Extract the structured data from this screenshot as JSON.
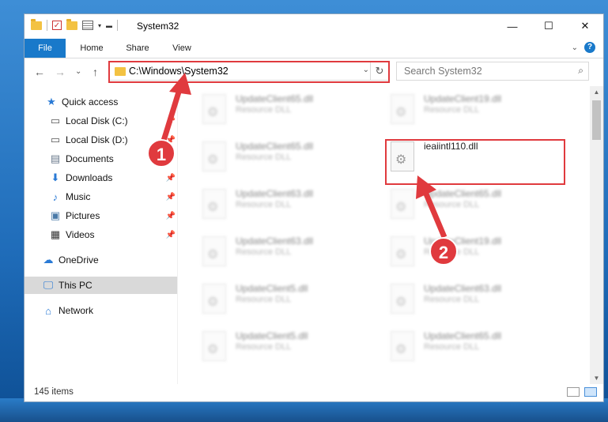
{
  "window": {
    "title": "System32",
    "controls": {
      "minimize": "—",
      "maximize": "☐",
      "close": "✕"
    }
  },
  "ribbon": {
    "tabs": [
      {
        "label": "File",
        "active": true
      },
      {
        "label": "Home"
      },
      {
        "label": "Share"
      },
      {
        "label": "View"
      }
    ],
    "help": "?"
  },
  "nav": {
    "back": "←",
    "forward": "→",
    "recent": "⌄",
    "up": "↑",
    "address": "C:\\Windows\\System32",
    "refresh": "↻",
    "search_placeholder": "Search System32"
  },
  "sidebar": {
    "items": [
      {
        "label": "Quick access",
        "icon": "star-icon"
      },
      {
        "label": "Local Disk (C:)",
        "icon": "drive-icon"
      },
      {
        "label": "Local Disk (D:)",
        "icon": "drive-icon"
      },
      {
        "label": "Documents",
        "icon": "documents-icon"
      },
      {
        "label": "Downloads",
        "icon": "download-icon"
      },
      {
        "label": "Music",
        "icon": "music-icon"
      },
      {
        "label": "Pictures",
        "icon": "pictures-icon"
      },
      {
        "label": "Videos",
        "icon": "videos-icon"
      },
      {
        "label": "OneDrive",
        "icon": "cloud-icon"
      },
      {
        "label": "This PC",
        "icon": "computer-icon",
        "selected": true
      },
      {
        "label": "Network",
        "icon": "network-icon"
      }
    ]
  },
  "files": {
    "left": [
      {
        "name": "UpdateClient65.dll",
        "type": "Resource DLL"
      },
      {
        "name": "UpdateClient65.dll",
        "type": "Resource DLL"
      },
      {
        "name": "UpdateClient63.dll",
        "type": "Resource DLL"
      },
      {
        "name": "UpdateClient63.dll",
        "type": "Resource DLL"
      },
      {
        "name": "UpdateClient5.dll",
        "type": "Resource DLL"
      },
      {
        "name": "UpdateClient5.dll",
        "type": "Resource DLL"
      }
    ],
    "right": [
      {
        "name": "UpdateClient19.dll",
        "type": "Resource DLL"
      },
      {
        "name": "ieaiintl110.dll",
        "type": "",
        "highlighted": true
      },
      {
        "name": "UpdateClient65.dll",
        "type": "Resource DLL"
      },
      {
        "name": "UpdateClient19.dll",
        "type": "Resource DLL"
      },
      {
        "name": "UpdateClient63.dll",
        "type": "Resource DLL"
      },
      {
        "name": "UpdateClient65.dll",
        "type": "Resource DLL"
      }
    ]
  },
  "status": {
    "count": "145 items"
  },
  "callouts": {
    "first": "1",
    "second": "2"
  },
  "colors": {
    "accent": "#1979ca",
    "highlight": "#e03a3e",
    "selected": "#d9d9d9"
  }
}
